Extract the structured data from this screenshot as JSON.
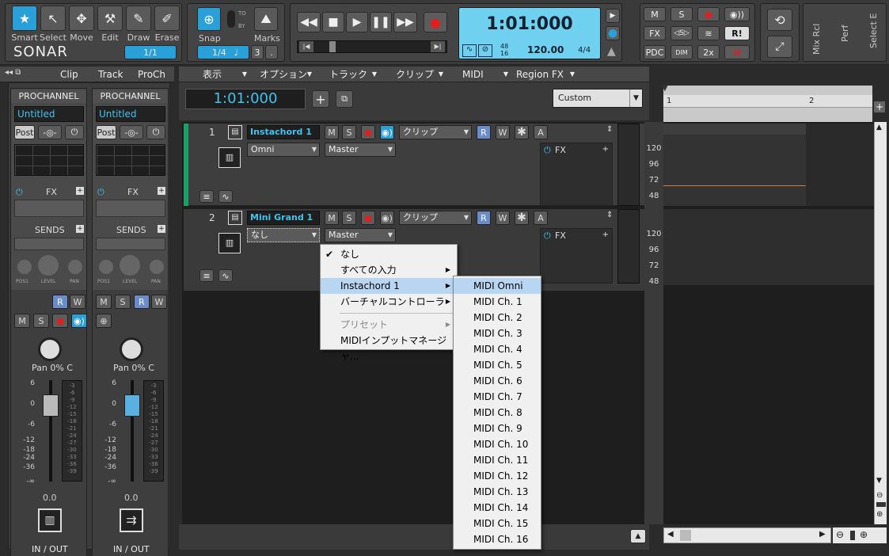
{
  "app": {
    "logo": "SONAR"
  },
  "tools": [
    {
      "label": "Smart"
    },
    {
      "label": "Select"
    },
    {
      "label": "Move"
    },
    {
      "label": "Edit"
    },
    {
      "label": "Draw"
    },
    {
      "label": "Erase"
    }
  ],
  "tool_page": "1/1",
  "snap": {
    "label": "Snap",
    "value": "1/4",
    "to": "TO",
    "by": "BY",
    "marks": "Marks",
    "num": "3"
  },
  "transport": {
    "time": "1:01:000",
    "tempo": "120.00",
    "meter": "4/4",
    "ts_top": "48",
    "ts_bottom": "16"
  },
  "mix_buttons": [
    "M",
    "S",
    "FX",
    "R!",
    "PDC",
    "DIM",
    "2x"
  ],
  "side_tabs": [
    "Mix Rcl",
    "Perf",
    "Select E"
  ],
  "insp_tabs": [
    "Clip",
    "Track",
    "ProCh"
  ],
  "strips": [
    {
      "proch": "PROCHANNEL",
      "name": "Untitled",
      "post": "Post",
      "fx": "FX",
      "sends": "SENDS",
      "pos1": "POS1",
      "level": "LEVEL",
      "pan": "PAN",
      "pan_val": "Pan  0% C",
      "vol": "0.0",
      "io": "IN / OUT"
    },
    {
      "proch": "PROCHANNEL",
      "name": "Untitled",
      "post": "Post",
      "fx": "FX",
      "sends": "SENDS",
      "pos1": "POS1",
      "level": "LEVEL",
      "pan": "PAN",
      "pan_val": "Pan  0% C",
      "vol": "0.0",
      "io": "IN / OUT"
    }
  ],
  "fader_scale": [
    "6",
    "0",
    "-6",
    "-12",
    "-18",
    "-24",
    "-36",
    "-∞"
  ],
  "meter_scale": [
    "-3",
    "-6",
    "-9",
    "-12",
    "-15",
    "-18",
    "-21",
    "-24",
    "-27",
    "-30",
    "-33",
    "-36",
    "-39"
  ],
  "menubar": [
    "表示",
    "オプション",
    "トラック",
    "クリップ",
    "MIDI",
    "Region FX"
  ],
  "track_view": {
    "time": "1:01:000",
    "preset": "Custom"
  },
  "tracks": [
    {
      "num": "1",
      "name": "Instachord 1",
      "input": "Omni",
      "output": "Master",
      "clip": "クリップ",
      "fx": "FX"
    },
    {
      "num": "2",
      "name": "Mini Grand 1",
      "input": "なし",
      "output": "Master",
      "clip": "クリップ",
      "fx": "FX"
    }
  ],
  "track_buttons": {
    "m": "M",
    "s": "S",
    "r": "R",
    "w": "W",
    "a": "A"
  },
  "vel_scale": [
    "120",
    "96",
    "72",
    "48"
  ],
  "ruler": {
    "m1": "1",
    "m2": "2"
  },
  "input_menu": [
    {
      "label": "なし",
      "checked": true
    },
    {
      "label": "すべての入力",
      "sub": true
    },
    {
      "label": "Instachord 1",
      "sub": true,
      "highlight": true
    },
    {
      "label": "バーチャルコントローラ",
      "sub": true
    },
    {
      "label": "プリセット",
      "sub": true,
      "disabled": true
    },
    {
      "label": "MIDIインプットマネージャ..."
    }
  ],
  "channel_menu": [
    "MIDI Omni",
    "MIDI Ch. 1",
    "MIDI Ch. 2",
    "MIDI Ch. 3",
    "MIDI Ch. 4",
    "MIDI Ch. 5",
    "MIDI Ch. 6",
    "MIDI Ch. 7",
    "MIDI Ch. 8",
    "MIDI Ch. 9",
    "MIDI Ch. 10",
    "MIDI Ch. 11",
    "MIDI Ch. 12",
    "MIDI Ch. 13",
    "MIDI Ch. 14",
    "MIDI Ch. 15",
    "MIDI Ch. 16"
  ]
}
